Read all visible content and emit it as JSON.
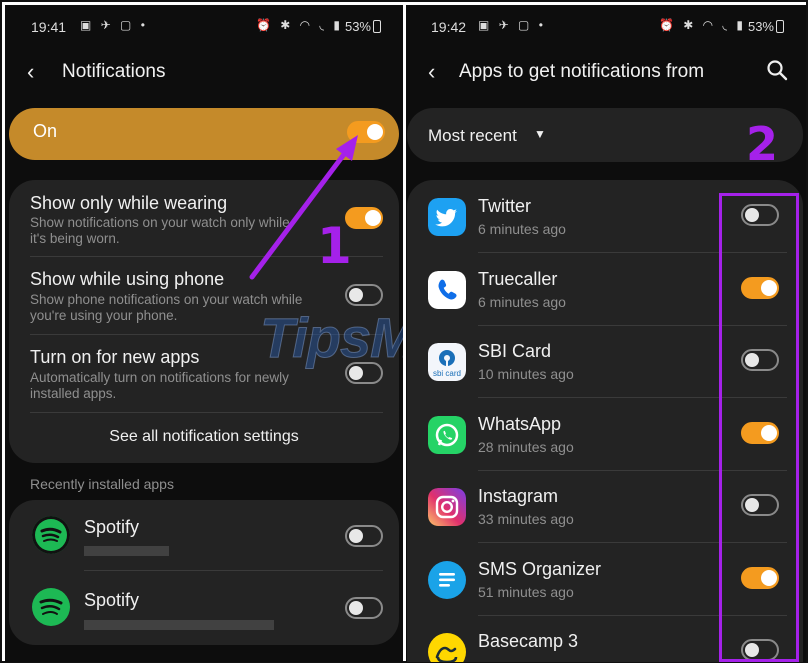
{
  "left": {
    "status": {
      "time": "19:41",
      "battery": "53%"
    },
    "header": {
      "title": "Notifications"
    },
    "master": {
      "label": "On",
      "on": true
    },
    "settings": [
      {
        "title": "Show only while wearing",
        "subtitle_line1": "Show notifications on your watch only while",
        "subtitle_line2": "it's being worn.",
        "on": true
      },
      {
        "title": "Show while using phone",
        "subtitle_line1": "Show phone notifications on your watch while",
        "subtitle_line2": "you're using your phone.",
        "on": false
      },
      {
        "title": "Turn on for new apps",
        "subtitle_line1": "Automatically turn on notifications for newly",
        "subtitle_line2": "installed apps.",
        "on": false
      }
    ],
    "see_all_label": "See all notification settings",
    "recent_label": "Recently installed apps",
    "recent_apps": [
      {
        "name": "Spotify",
        "on": false
      },
      {
        "name": "Spotify",
        "on": false
      }
    ]
  },
  "right": {
    "status": {
      "time": "19:42",
      "battery": "53%"
    },
    "header": {
      "title": "Apps to get notifications from"
    },
    "sort": {
      "selected": "Most recent"
    },
    "apps": [
      {
        "name": "Twitter",
        "time": "6 minutes ago",
        "on": false,
        "icon": "twitter-icon"
      },
      {
        "name": "Truecaller",
        "time": "6 minutes ago",
        "on": true,
        "icon": "truecaller-icon"
      },
      {
        "name": "SBI Card",
        "time": "10 minutes ago",
        "on": false,
        "icon": "sbi-card-icon"
      },
      {
        "name": "WhatsApp",
        "time": "28 minutes ago",
        "on": true,
        "icon": "whatsapp-icon"
      },
      {
        "name": "Instagram",
        "time": "33 minutes ago",
        "on": false,
        "icon": "instagram-icon"
      },
      {
        "name": "SMS Organizer",
        "time": "51 minutes ago",
        "on": true,
        "icon": "sms-organizer-icon"
      },
      {
        "name": "Basecamp 3",
        "time": "",
        "on": false,
        "icon": "basecamp-icon"
      }
    ]
  },
  "annotations": {
    "step1": "1",
    "step2": "2",
    "watermark": "TipsMake"
  },
  "colors": {
    "accent": "#f49b1f",
    "highlight": "#a521ea",
    "master_bar": "#c58a2a"
  }
}
